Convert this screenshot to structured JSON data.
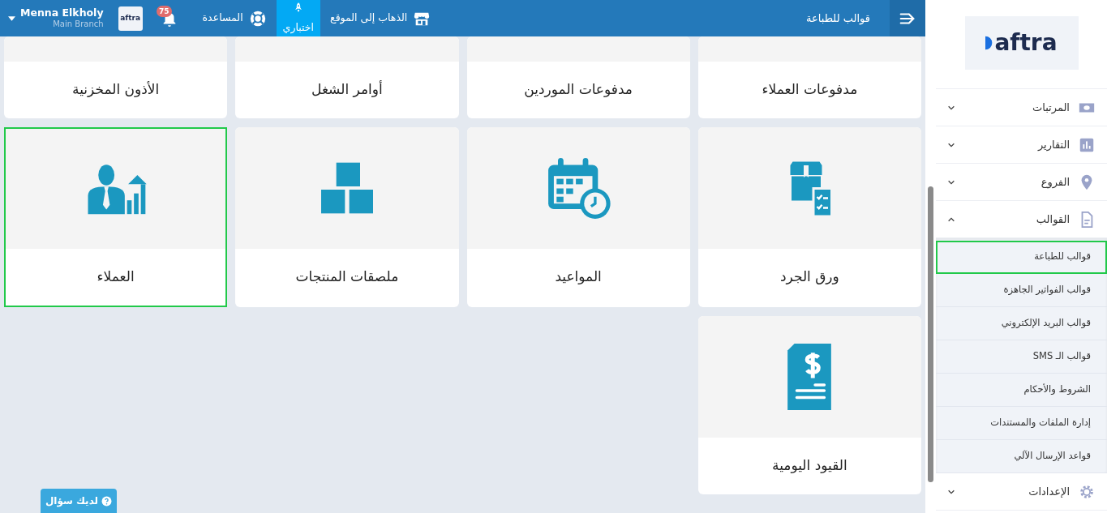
{
  "topbar": {
    "page_title": "قوالب للطباعة",
    "links": [
      {
        "kind": "store",
        "label": "الذهاب إلى الموقع",
        "selected": false
      },
      {
        "kind": "test",
        "label": "اختباري",
        "selected": true
      },
      {
        "kind": "help",
        "label": "المساعدة",
        "selected": false
      }
    ],
    "notifications": {
      "count": "75"
    },
    "logo": "aftra",
    "user": {
      "name": "Menna Elkholy",
      "branch": "Main Branch"
    }
  },
  "sidebar": {
    "logo": "aftra",
    "items": [
      {
        "label": "المرتبات",
        "kind": "money",
        "expanded": false
      },
      {
        "label": "التقارير",
        "kind": "chart",
        "expanded": false
      },
      {
        "label": "الفروع",
        "kind": "pin",
        "expanded": false
      },
      {
        "label": "القوالب",
        "kind": "doc",
        "expanded": true,
        "children": [
          {
            "label": "قوالب للطباعة",
            "selected": true
          },
          {
            "label": "قوالب الفواتير الجاهزة",
            "selected": false
          },
          {
            "label": "قوالب البريد الإلكتروني",
            "selected": false
          },
          {
            "label": "قوالب الـ SMS",
            "selected": false
          },
          {
            "label": "الشروط والأحكام",
            "selected": false
          },
          {
            "label": "إدارة الملفات والمستندات",
            "selected": false
          },
          {
            "label": "قواعد الإرسال الآلي",
            "selected": false
          }
        ]
      },
      {
        "label": "الإعدادات",
        "kind": "gear",
        "expanded": false
      }
    ]
  },
  "cards": [
    {
      "label": "مدفوعات العملاء",
      "selected": false
    },
    {
      "label": "مدفوعات الموردين",
      "selected": false
    },
    {
      "label": "أوامر الشغل",
      "selected": false
    },
    {
      "label": "الأذون المخزنية",
      "selected": false
    },
    {
      "label": "ورق الجرد",
      "kind": "inventory",
      "selected": false
    },
    {
      "label": "المواعيد",
      "kind": "calendar",
      "selected": false
    },
    {
      "label": "ملصقات المنتجات",
      "kind": "cubes",
      "selected": false
    },
    {
      "label": "العملاء",
      "kind": "clients",
      "selected": true
    },
    {
      "label": "القيود اليومية",
      "kind": "journal",
      "selected": false
    }
  ],
  "help_button": {
    "label": "لديك سؤال"
  }
}
